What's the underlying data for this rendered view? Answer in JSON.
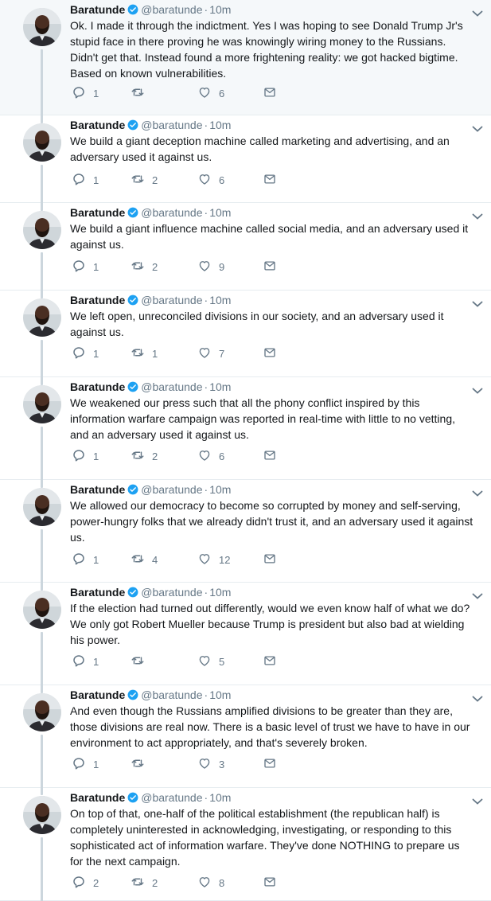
{
  "author": {
    "display_name": "Baratunde",
    "handle": "@baratunde",
    "separator": "·"
  },
  "colors": {
    "verified": "#1da1f2",
    "icon_gray": "#657786",
    "thread_line": "#ccd6dd",
    "highlight_bg": "#f5f8fa"
  },
  "icons": {
    "reply": "reply-icon",
    "retweet": "retweet-icon",
    "like": "heart-icon",
    "dm": "envelope-icon",
    "caret": "chevron-down-icon",
    "verified": "verified-badge-icon"
  },
  "tweets": [
    {
      "time": "10m",
      "text": "Ok. I made it through the indictment. Yes I was hoping to see Donald Trump Jr's stupid face in there proving he was knowingly wiring money to the Russians. Didn't get that. Instead found a more frightening reality: we got hacked bigtime. Based on known vulnerabilities.",
      "replies": "1",
      "retweets": "",
      "likes": "6"
    },
    {
      "time": "10m",
      "text": "We build a giant deception machine called marketing and advertising, and an adversary used it against us.",
      "replies": "1",
      "retweets": "2",
      "likes": "6"
    },
    {
      "time": "10m",
      "text": "We build a giant influence machine called social media, and an adversary used it against us.",
      "replies": "1",
      "retweets": "2",
      "likes": "9"
    },
    {
      "time": "10m",
      "text": "We left open, unreconciled divisions in our society, and an adversary used it against us.",
      "replies": "1",
      "retweets": "1",
      "likes": "7"
    },
    {
      "time": "10m",
      "text": "We weakened our press such that all the phony conflict inspired by this information warfare campaign was reported in real-time with little to no vetting, and an adversary used it against us.",
      "replies": "1",
      "retweets": "2",
      "likes": "6"
    },
    {
      "time": "10m",
      "text": "We allowed our democracy to become so corrupted by money and self-serving, power-hungry folks that we already didn't trust it, and an adversary used it against us.",
      "replies": "1",
      "retweets": "4",
      "likes": "12"
    },
    {
      "time": "10m",
      "text": "If the election had turned out differently, would we even know half of what we do? We only got Robert Mueller because Trump is president but also bad at wielding his power.",
      "replies": "1",
      "retweets": "",
      "likes": "5"
    },
    {
      "time": "10m",
      "text": "And even though the Russians amplified divisions to be greater than they are, those divisions are real now. There is a basic level of trust we have to have in our environment to act appropriately, and that's severely broken.",
      "replies": "1",
      "retweets": "",
      "likes": "3"
    },
    {
      "time": "10m",
      "text": "On top of that, one-half of the political establishment (the republican half) is completely uninterested in acknowledging, investigating, or responding to this sophisticated act of information warfare. They've done NOTHING to prepare us for the next campaign.",
      "replies": "2",
      "retweets": "2",
      "likes": "8"
    }
  ]
}
